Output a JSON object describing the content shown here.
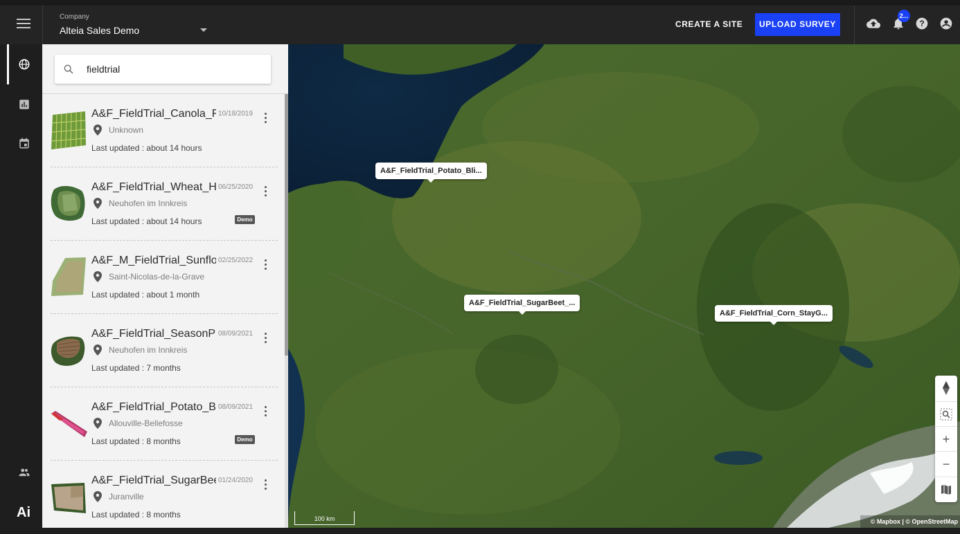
{
  "header": {
    "company_label": "Company",
    "company_name": "Alteia Sales Demo",
    "create_site_label": "CREATE A SITE",
    "upload_survey_label": "UPLOAD SURVEY",
    "notification_count": "2...",
    "icons": [
      "menu-icon",
      "cloud-upload-icon",
      "bell-icon",
      "help-icon",
      "account-icon"
    ],
    "accent_color": "#1a41f5"
  },
  "rail": {
    "icons": [
      "globe-icon",
      "chart-icon",
      "calendar-icon",
      "team-icon"
    ],
    "logo": "Ai"
  },
  "search": {
    "value": "fieldtrial",
    "placeholder": ""
  },
  "sites": [
    {
      "name": "A&F_FieldTrial_Canola_Fl...",
      "date": "10/18/2019",
      "location": "Unknown",
      "updated": "Last updated : about 14 hours",
      "badge": ""
    },
    {
      "name": "A&F_FieldTrial_Wheat_He...",
      "date": "06/25/2020",
      "location": "Neuhofen im Innkreis",
      "updated": "Last updated : about 14 hours",
      "badge": "Demo"
    },
    {
      "name": "A&F_M_FieldTrial_Sunflo...",
      "date": "02/25/2022",
      "location": "Saint-Nicolas-de-la-Grave",
      "updated": "Last updated : about 1 month",
      "badge": ""
    },
    {
      "name": "A&F_FieldTrial_SeasonPla...",
      "date": "08/09/2021",
      "location": "Neuhofen im Innkreis",
      "updated": "Last updated : 7 months",
      "badge": ""
    },
    {
      "name": "A&F_FieldTrial_Potato_Bli...",
      "date": "08/09/2021",
      "location": "Allouville-Bellefosse",
      "updated": "Last updated : 8 months",
      "badge": "Demo"
    },
    {
      "name": "A&F_FieldTrial_SugarBeet...",
      "date": "01/24/2020",
      "location": "Juranville",
      "updated": "Last updated : 8 months",
      "badge": ""
    }
  ],
  "map": {
    "markers": [
      {
        "label": "A&F_FieldTrial_Potato_Bli..."
      },
      {
        "label": "A&F_FieldTrial_SugarBeet_..."
      },
      {
        "label": "A&F_FieldTrial_Corn_StayG..."
      }
    ],
    "scale": "100 km",
    "attribution": "© Mapbox | © OpenStreetMap",
    "controls": [
      "compass-icon",
      "zoom-to-fit-icon",
      "zoom-in-icon",
      "zoom-out-icon",
      "map-layers-icon"
    ]
  }
}
